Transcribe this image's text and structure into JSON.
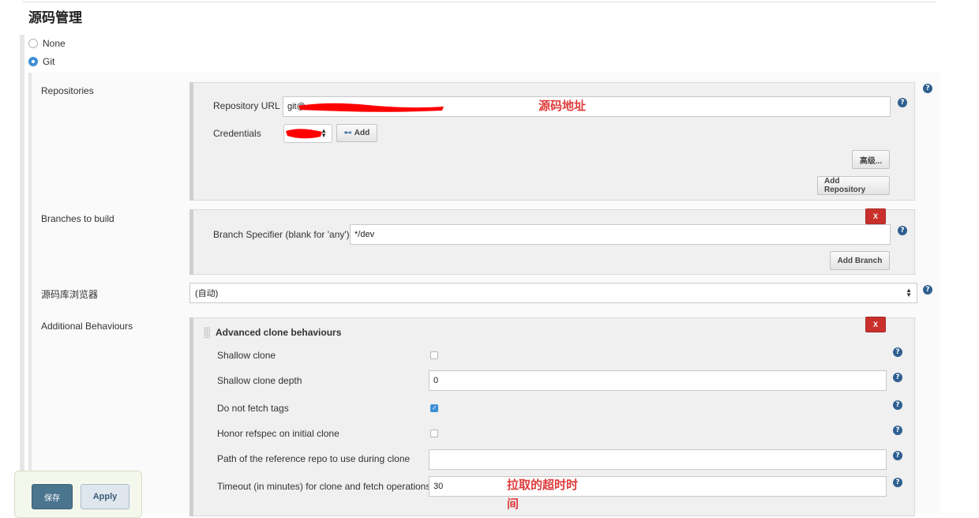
{
  "section_title": "源码管理",
  "scm_options": [
    {
      "label": "None",
      "selected": false
    },
    {
      "label": "Git",
      "selected": true
    }
  ],
  "repositories": {
    "label": "Repositories",
    "url_label": "Repository URL",
    "url_value": "git@",
    "url_annotation": "源码地址",
    "credentials_label": "Credentials",
    "add_button": "Add",
    "advanced_button": "高级...",
    "add_repository_button": "Add Repository"
  },
  "branches": {
    "label": "Branches to build",
    "specifier_label": "Branch Specifier (blank for 'any')",
    "specifier_value": "*/dev",
    "delete_button": "X",
    "add_branch_button": "Add Branch"
  },
  "browser": {
    "label": "源码库浏览器",
    "selected": "(自动)"
  },
  "additional": {
    "label": "Additional Behaviours",
    "panel_title": "Advanced clone behaviours",
    "delete_button": "X",
    "shallow_clone": {
      "label": "Shallow clone",
      "checked": false
    },
    "shallow_depth": {
      "label": "Shallow clone depth",
      "value": "0"
    },
    "no_tags": {
      "label": "Do not fetch tags",
      "checked": true
    },
    "honor_refspec": {
      "label": "Honor refspec on initial clone",
      "checked": false
    },
    "reference_repo": {
      "label": "Path of the reference repo to use during clone",
      "value": ""
    },
    "timeout": {
      "label": "Timeout (in minutes) for clone and fetch operations",
      "value": "30",
      "annotation_line1": "拉取的超时时",
      "annotation_line2": "间"
    }
  },
  "footer": {
    "save_button": "保存",
    "apply_button": "Apply"
  },
  "colors": {
    "accent": "#3d8fd6",
    "annotation": "#e03c3c",
    "delete": "#c9302c",
    "save": "#4b748f",
    "redaction": "#ff0000"
  }
}
